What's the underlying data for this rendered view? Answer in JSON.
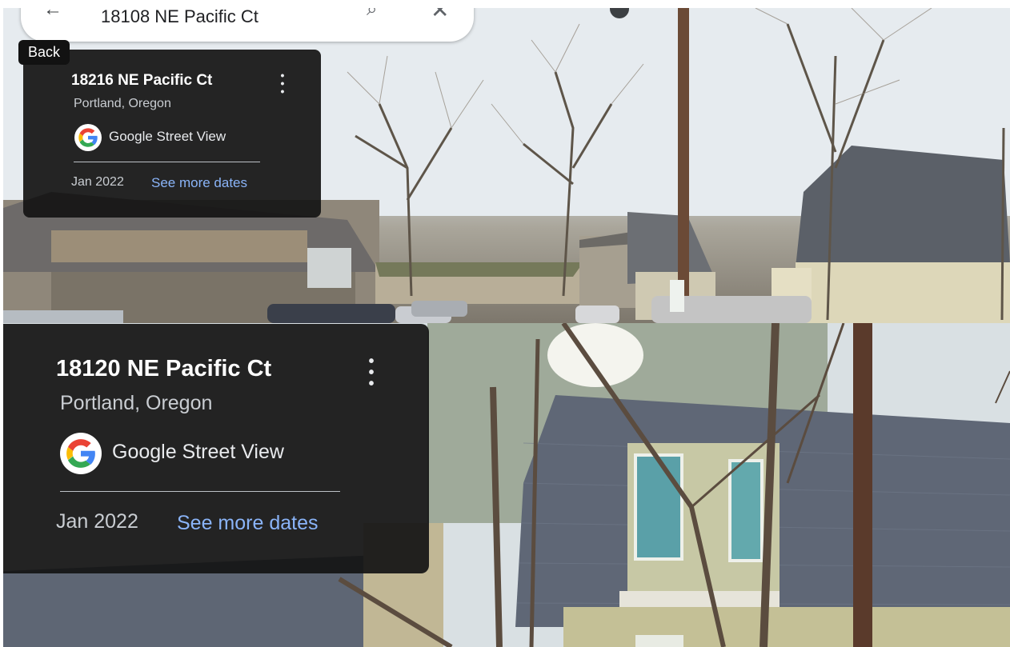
{
  "search": {
    "query": "18108 NE Pacific Ct"
  },
  "tooltip": {
    "back_label": "Back"
  },
  "cards": {
    "top": {
      "title": "18216 NE Pacific Ct",
      "subtitle": "Portland, Oregon",
      "source": "Google Street View",
      "date": "Jan 2022",
      "more_dates_label": "See more dates"
    },
    "bottom": {
      "title": "18120 NE Pacific Ct",
      "subtitle": "Portland, Oregon",
      "source": "Google Street View",
      "date": "Jan 2022",
      "more_dates_label": "See more dates"
    }
  },
  "icons": {
    "back": "arrow-left",
    "search": "magnifier",
    "close": "x",
    "more": "vertical-ellipsis",
    "source": "google-g-logo"
  }
}
